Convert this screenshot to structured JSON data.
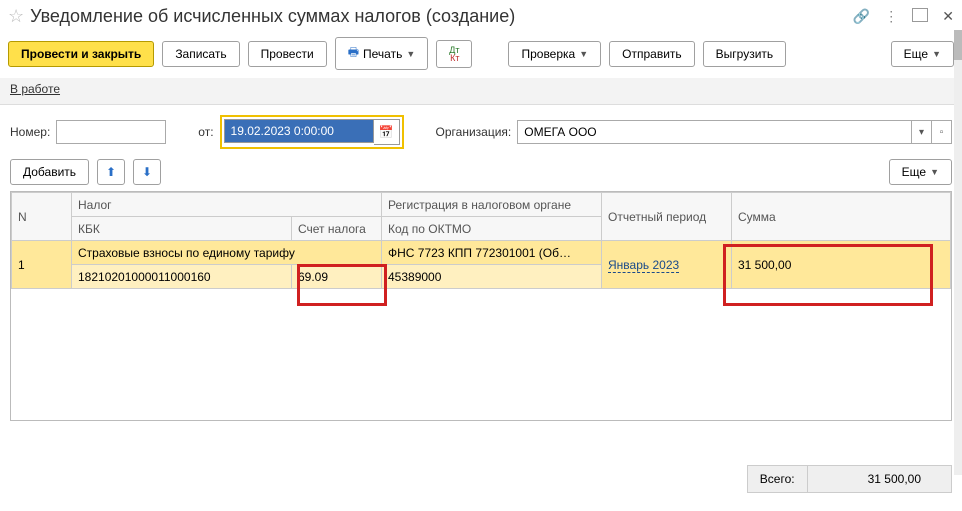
{
  "window": {
    "title": "Уведомление об исчисленных суммах налогов (создание)"
  },
  "toolbar": {
    "post_close": "Провести и закрыть",
    "save": "Записать",
    "post": "Провести",
    "print": "Печать",
    "check": "Проверка",
    "send": "Отправить",
    "export": "Выгрузить",
    "more": "Еще"
  },
  "link": {
    "in_work": "В работе"
  },
  "form": {
    "number_label": "Номер:",
    "number_value": "",
    "from_label": "от:",
    "date_value": "19.02.2023  0:00:00",
    "org_label": "Организация:",
    "org_value": "ОМЕГА ООО"
  },
  "table_toolbar": {
    "add": "Добавить",
    "more": "Еще"
  },
  "grid": {
    "headers": {
      "n": "N",
      "tax": "Налог",
      "kbk": "КБК",
      "acc": "Счет налога",
      "reg": "Регистрация в налоговом органе",
      "oktmo": "Код по ОКТМО",
      "period": "Отчетный период",
      "sum": "Сумма"
    },
    "rows": [
      {
        "n": "1",
        "tax": "Страховые взносы по единому тарифу",
        "kbk": "18210201000011000160",
        "acc": "69.09",
        "reg": "ФНС 7723 КПП 772301001 (Об…",
        "oktmo": "45389000",
        "period": "Январь 2023",
        "sum": "31 500,00"
      }
    ]
  },
  "totals": {
    "label": "Всего:",
    "value": "31 500,00"
  }
}
